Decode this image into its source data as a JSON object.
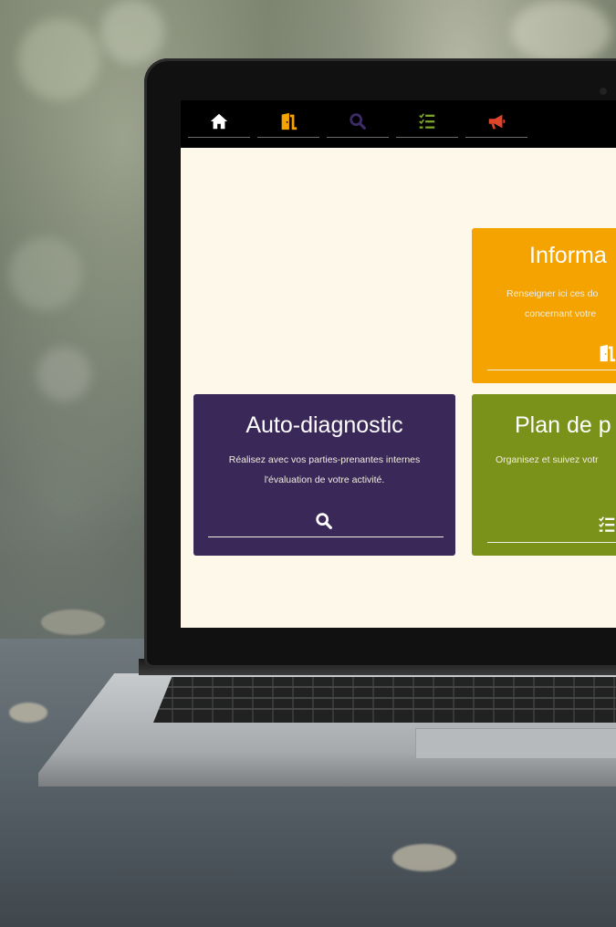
{
  "nav": {
    "items": [
      {
        "icon": "home-icon",
        "color": "#ffffff"
      },
      {
        "icon": "door-exit-icon",
        "color": "#f4a300"
      },
      {
        "icon": "search-icon",
        "color": "#3b2b66"
      },
      {
        "icon": "checklist-icon",
        "color": "#7ea52a"
      },
      {
        "icon": "megaphone-icon",
        "color": "#e0452c"
      }
    ]
  },
  "cards": {
    "information": {
      "title": "Informa",
      "text_line1": "Renseigner ici ces do",
      "text_line2": "concernant votre",
      "icon": "door-exit-icon",
      "color": "#f4a300"
    },
    "auto_diagnostic": {
      "title": "Auto-diagnostic",
      "text_line1": "Réalisez avec vos parties-prenantes internes",
      "text_line2": "l'évaluation de votre activité.",
      "icon": "search-icon",
      "color": "#3a2858"
    },
    "plan": {
      "title": "Plan de p",
      "text_line1": "Organisez et suivez votr",
      "icon": "checklist-icon",
      "color": "#7a911a"
    }
  }
}
